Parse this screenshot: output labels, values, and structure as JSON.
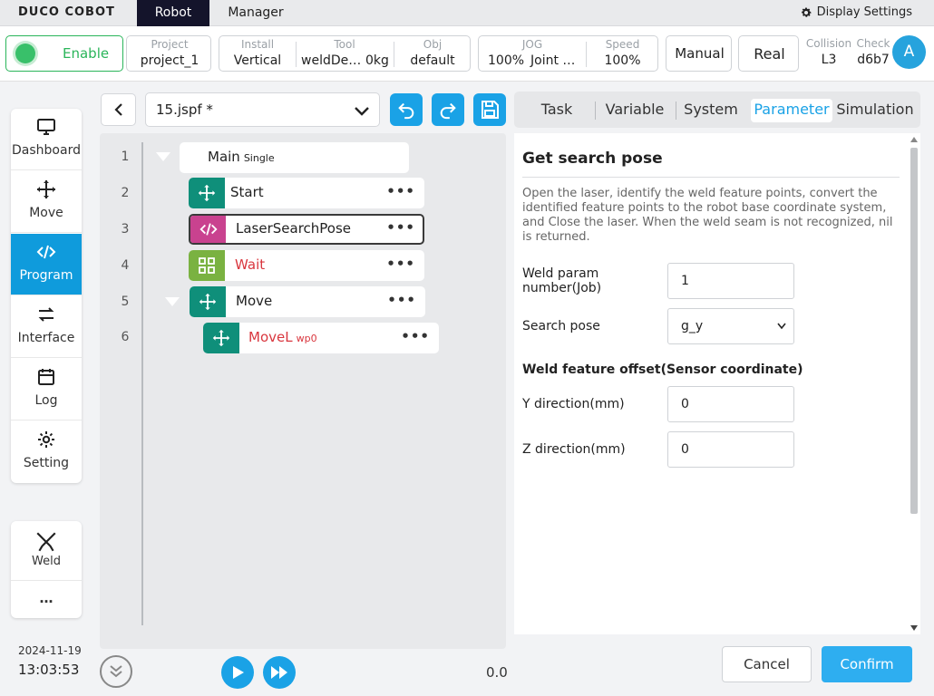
{
  "topbar": {
    "logo": "DUCO COBOT",
    "tabs": [
      "Robot",
      "Manager"
    ],
    "display_settings": "Display Settings"
  },
  "status": {
    "enable": "Enable",
    "project_label": "Project",
    "project_value": "project_1",
    "install_label": "Install",
    "install_value": "Vertical",
    "tool_label": "Tool",
    "tool_name": "weldDe…",
    "tool_weight": "0kg",
    "obj_label": "Obj",
    "obj_value": "default",
    "jog_label": "JOG",
    "jog_percent": "100%",
    "jog_mode": "Joint …",
    "speed_label": "Speed",
    "speed_value": "100%",
    "manual": "Manual",
    "real": "Real",
    "collision_label": "Collision",
    "collision_value": "L3",
    "check_label": "Check",
    "check_value": "d6b7",
    "avatar": "A"
  },
  "sidebar": {
    "items": [
      {
        "label": "Dashboard",
        "icon": "monitor-icon"
      },
      {
        "label": "Move",
        "icon": "move-arrows-icon"
      },
      {
        "label": "Program",
        "icon": "code-icon",
        "active": true
      },
      {
        "label": "Interface",
        "icon": "swap-icon"
      },
      {
        "label": "Log",
        "icon": "calendar-icon"
      },
      {
        "label": "Setting",
        "icon": "gear-icon"
      }
    ],
    "weld": "Weld",
    "more": "…",
    "date": "2024-11-19",
    "time": "13:03:53"
  },
  "program": {
    "file": "15.jspf *",
    "lines": [
      {
        "num": "1",
        "label": "Main",
        "sub": "Single",
        "type": "main"
      },
      {
        "num": "2",
        "label": "Start",
        "type": "move",
        "color": "#0f8f7a"
      },
      {
        "num": "3",
        "label": "LaserSearchPose",
        "type": "code",
        "color": "#c9428f",
        "selected": true
      },
      {
        "num": "4",
        "label": "Wait",
        "type": "wait",
        "color": "#7ab241",
        "label_color": "#d9363e"
      },
      {
        "num": "5",
        "label": "Move",
        "type": "move",
        "color": "#0f8f7a"
      },
      {
        "num": "6",
        "label": "MoveL",
        "sub": "wp0",
        "type": "move",
        "color": "#0f8f7a",
        "label_color": "#d9363e"
      }
    ],
    "menu_glyph": "•••",
    "speed_readout": "0.0"
  },
  "panel": {
    "tabs": [
      "Task",
      "Variable",
      "System",
      "Parameter",
      "Simulation"
    ],
    "active_tab": "Parameter",
    "title": "Get search pose",
    "description": "Open the laser, identify the weld feature points, convert the identified feature points to the robot base coordinate system, and Close the laser. When the weld seam is not recognized, nil is returned.",
    "weld_param_label": "Weld param number(Job)",
    "weld_param_value": "1",
    "search_pose_label": "Search pose",
    "search_pose_value": "g_y",
    "offset_section": "Weld feature offset(Sensor coordinate)",
    "y_label": "Y direction(mm)",
    "y_value": "0",
    "z_label": "Z direction(mm)",
    "z_value": "0",
    "cancel": "Cancel",
    "confirm": "Confirm"
  },
  "colors": {
    "accent": "#1aa2e6",
    "enable_green": "#2ab55a",
    "nav_dark": "#14142b"
  }
}
